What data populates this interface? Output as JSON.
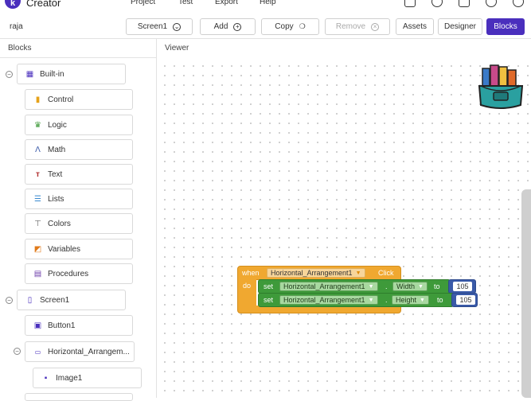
{
  "app": {
    "logo_letter": "k",
    "name": "Creator"
  },
  "menu": {
    "items": [
      "Project",
      "Test",
      "Export",
      "Help"
    ]
  },
  "toolbar": {
    "project_name": "raja",
    "screen_label": "Screen1",
    "add_label": "Add",
    "copy_label": "Copy",
    "remove_label": "Remove",
    "assets_label": "Assets",
    "designer_label": "Designer",
    "blocks_label": "Blocks"
  },
  "panels": {
    "blocks_title": "Blocks",
    "viewer_title": "Viewer"
  },
  "tree": {
    "builtin": "Built-in",
    "categories": [
      "Control",
      "Logic",
      "Math",
      "Text",
      "Lists",
      "Colors",
      "Variables",
      "Procedures"
    ],
    "screen": "Screen1",
    "components": [
      "Button1",
      "Horizontal_Arrangem...",
      "Image1"
    ]
  },
  "workspace": {
    "when": "when",
    "component": "Horizontal_Arrangement1",
    "event": "Click",
    "do": "do",
    "set": "set",
    "to": "to",
    "rows": [
      {
        "component": "Horizontal_Arrangement1",
        "property": "Width",
        "value": "105"
      },
      {
        "component": "Horizontal_Arrangement1",
        "property": "Height",
        "value": "105"
      }
    ]
  },
  "colors": {
    "accent": "#4a2fbd",
    "event_block": "#f0a830",
    "set_block": "#3e9a3a",
    "number_block": "#3a5aa8"
  }
}
